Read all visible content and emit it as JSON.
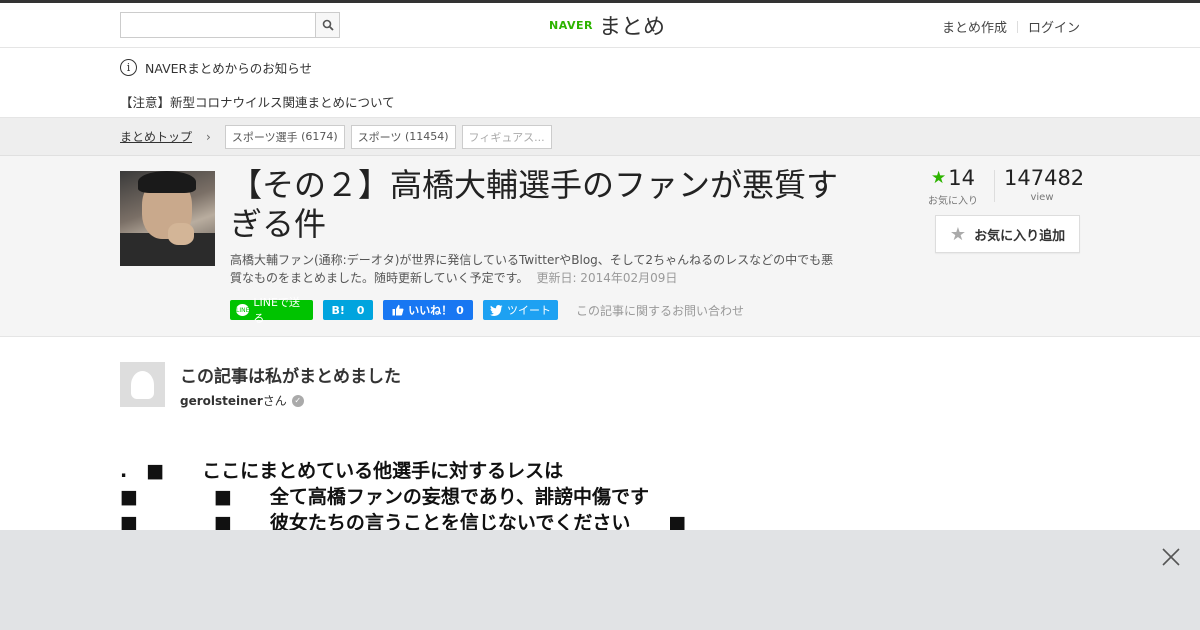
{
  "header": {
    "search": {
      "value": "",
      "placeholder": ""
    },
    "logo": {
      "brand": "NAVER",
      "service": "まとめ"
    },
    "nav": [
      "まとめ作成",
      "ログイン"
    ]
  },
  "notice": {
    "title": "NAVERまとめからのお知らせ",
    "item": "【注意】新型コロナウイルス関連まとめについて"
  },
  "breadcrumb": {
    "top": "まとめトップ",
    "tags": [
      {
        "label": "スポーツ選手",
        "count": "(6174)"
      },
      {
        "label": "スポーツ",
        "count": "(11454)"
      },
      {
        "label": "フィギュアス...",
        "count": ""
      }
    ]
  },
  "article": {
    "title": "【その２】高橋大輔選手のファンが悪質すぎる件",
    "description": "高橋大輔ファン(通称:デーオタ)が世界に発信しているTwitterやBlog、そして2ちゃんねるのレスなどの中でも悪質なものをまとめました。随時更新していく予定です。",
    "updated": "更新日: 2014年02月09日",
    "favorites": {
      "count": "14",
      "label": "お気に入り"
    },
    "views": {
      "count": "147482",
      "label": "view"
    },
    "fav_button": "お気に入り追加",
    "share": {
      "line": "LINEで送る",
      "hatena": "0",
      "facebook": "いいね！ 0",
      "twitter": "ツイート"
    },
    "contact": "この記事に関するお問い合わせ"
  },
  "author": {
    "heading": "この記事は私がまとめました",
    "name": "gerolsteiner",
    "suffix": "さん"
  },
  "body": {
    "line1": ".　■　　ここにまとめている他選手に対するレスは",
    "line2": "■　　　　■　　全て高橋ファンの妄想であり、誹謗中傷です",
    "line3": "■　　　　■　　彼女たちの言うことを信じないでください　　■"
  },
  "colors": {
    "accent": "#2db400",
    "line": "#00c300",
    "hatena": "#00a4de",
    "facebook": "#1877f2",
    "twitter": "#1da1f2"
  }
}
